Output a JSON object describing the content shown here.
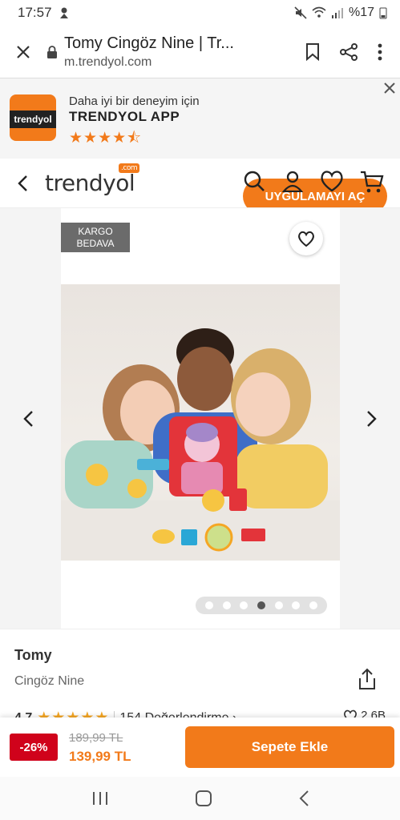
{
  "status": {
    "time": "17:57",
    "battery": "%17"
  },
  "browser": {
    "title": "Tomy Cingöz Nine | Tr...",
    "url": "m.trendyol.com"
  },
  "banner": {
    "line1": "Daha iyi bir deneyim için",
    "line2": "TRENDYOL APP",
    "stars": "★★★★⯪",
    "app_icon_text": "trendyol",
    "open_label": "UYGULAMAYI AÇ"
  },
  "header": {
    "logo": "trendyol",
    "logo_com": ".com"
  },
  "gallery": {
    "badge_line1": "KARGO",
    "badge_line2": "BEDAVA",
    "dot_count": 7,
    "active_dot": 4
  },
  "product": {
    "brand": "Tomy",
    "name": "Cingöz Nine",
    "rating": "4.7",
    "stars": "★★★★★",
    "reviews": "154 Değerlendirme ›",
    "favorites": "2,6B"
  },
  "pricebar": {
    "discount": "-26%",
    "old_price": "189,99 TL",
    "new_price": "139,99 TL",
    "add_label": "Sepete Ekle"
  },
  "colors": {
    "brand": "#f27a1a",
    "discount": "#d0021b"
  }
}
